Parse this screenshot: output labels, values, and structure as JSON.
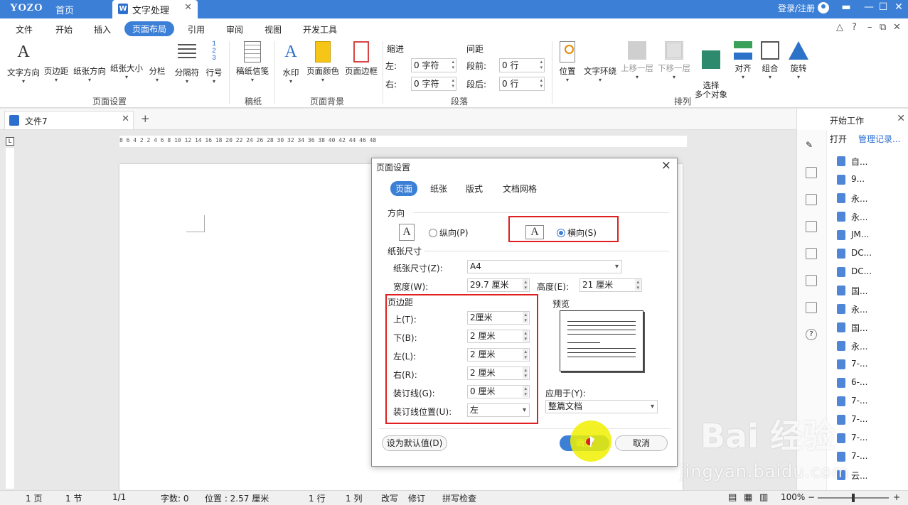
{
  "titlebar": {
    "logo": "YOZO",
    "home": "首页",
    "doc_tab": "文字处理",
    "login": "登录/注册"
  },
  "menu": [
    "文件",
    "开始",
    "插入",
    "页面布局",
    "引用",
    "审阅",
    "视图",
    "开发工具"
  ],
  "ribbon": {
    "buttons": [
      "文字方向",
      "页边距",
      "纸张方向",
      "纸张大小",
      "分栏",
      "分隔符",
      "行号",
      "稿纸信笺",
      "水印",
      "页面颜色",
      "页面边框",
      "位置",
      "文字环绕",
      "上移一层",
      "下移一层",
      "选择\n多个对象",
      "对齐",
      "组合",
      "旋转"
    ],
    "groups": [
      "页面设置",
      "稿纸",
      "页面背景",
      "段落",
      "排列"
    ],
    "indent_title": "缩进",
    "spacing_title": "间距",
    "indent_left_label": "左:",
    "indent_left_value": "0 字符",
    "indent_right_label": "右:",
    "indent_right_value": "0 字符",
    "space_before_label": "段前:",
    "space_before_value": "0 行",
    "space_after_label": "段后:",
    "space_after_value": "0 行"
  },
  "doc_tab": {
    "name": "文件7",
    "add": "+"
  },
  "ruler_numbers": "8   6   4   2       2   4   6   8  10  12  14  16  18  20  22  24  26  28  30  32  34  36  38  40  42  44  46  48",
  "right_panel": {
    "title": "开始工作",
    "open": "打开",
    "manage": "管理记录...",
    "items": [
      "自...",
      "9...",
      "永...",
      "永...",
      "JM...",
      "DC...",
      "DC...",
      "国...",
      "永...",
      "国...",
      "永...",
      "7-...",
      "6-...",
      "7-...",
      "7-...",
      "7-...",
      "7-...",
      "云..."
    ]
  },
  "status": {
    "page": "1 页",
    "section": "1 节",
    "pages": "1/1",
    "words": "字数: 0",
    "position": "位置 : 2.57 厘米",
    "line": "1 行",
    "col": "1 列",
    "overwrite": "改写",
    "revise": "修订",
    "spell": "拼写检查",
    "zoom": "100%"
  },
  "dialog": {
    "title": "页面设置",
    "tabs": [
      "页面",
      "纸张",
      "版式",
      "文档网格"
    ],
    "orientation_label": "方向",
    "portrait": "纵向(P)",
    "landscape": "横向(S)",
    "paper_label": "纸张尺寸",
    "paper_size_label": "纸张尺寸(Z):",
    "paper_size_value": "A4",
    "width_label": "宽度(W):",
    "width_value": "29.7 厘米",
    "height_label": "高度(E):",
    "height_value": "21 厘米",
    "margins_label": "页边距",
    "top_label": "上(T):",
    "top_value": "2厘米",
    "bottom_label": "下(B):",
    "bottom_value": "2 厘米",
    "left_label": "左(L):",
    "left_value": "2 厘米",
    "right_label": "右(R):",
    "right_value": "2 厘米",
    "gutter_label": "装订线(G):",
    "gutter_value": "0 厘米",
    "gutter_pos_label": "装订线位置(U):",
    "gutter_pos_value": "左",
    "preview_label": "预览",
    "apply_label": "应用于(Y):",
    "apply_value": "整篇文档",
    "default_button": "设为默认值(D)",
    "ok_button": "确定",
    "cancel_button": "取消"
  },
  "watermark": {
    "brand": "Bai 经验",
    "url": "jingyan.baidu.com"
  },
  "colors": {
    "accent": "#3b7fd6",
    "highlight_box": "#e02020"
  }
}
